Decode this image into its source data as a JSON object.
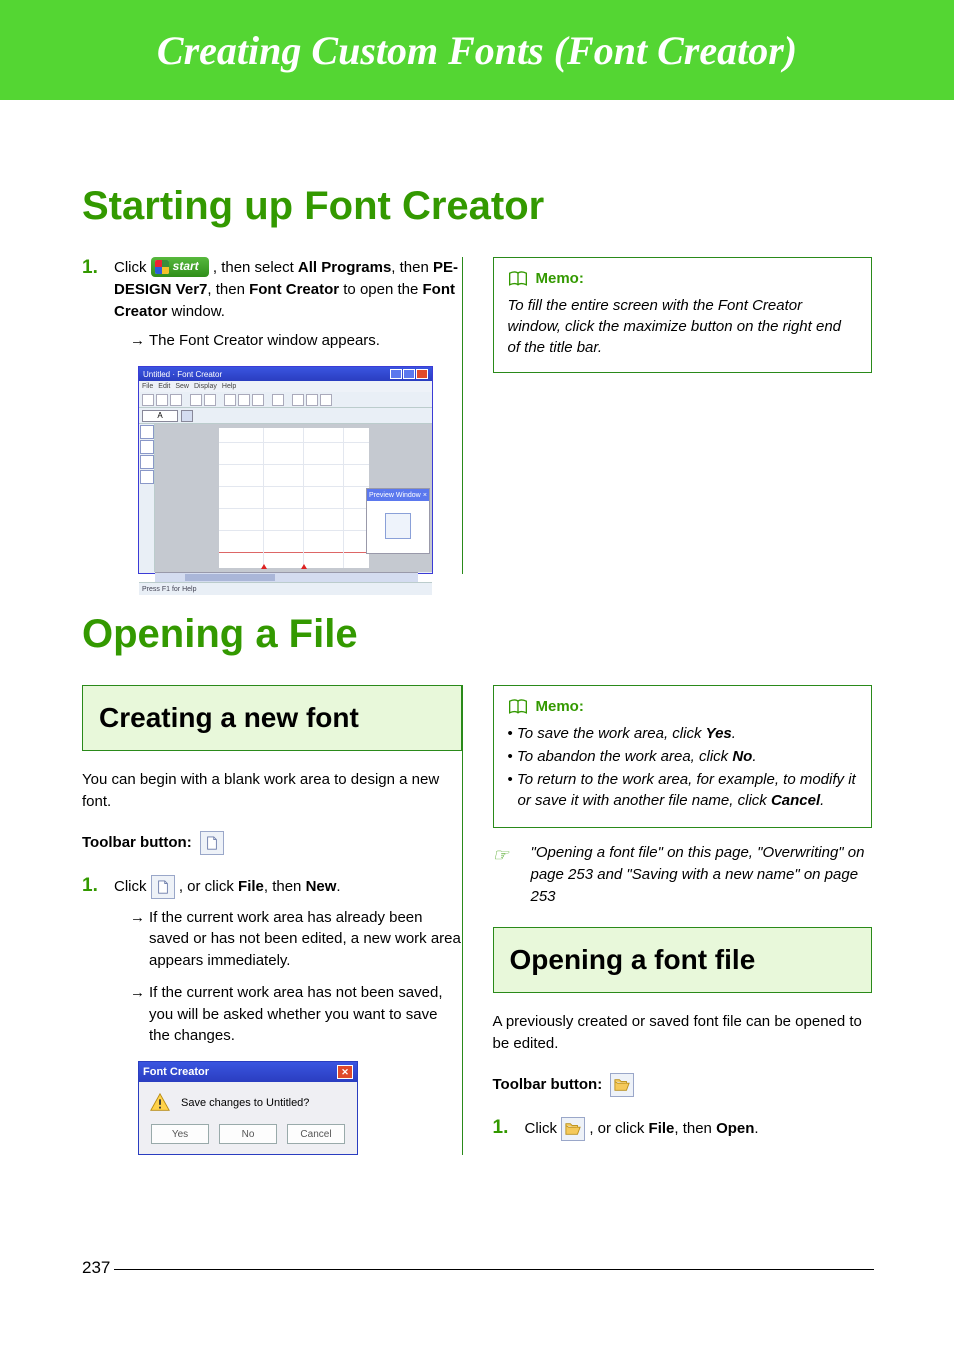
{
  "banner": {
    "title": "Creating Custom Fonts (Font Creator)"
  },
  "section1": {
    "heading": "Starting up Font Creator",
    "step1_prefix": "Click ",
    "start_label": "start",
    "step1_mid": ", then select ",
    "step1_b1": "All Programs",
    "step1_mid2": ", then ",
    "step1_b2": "PE-DESIGN Ver7",
    "step1_mid3": ", then ",
    "step1_b3": "Font Creator",
    "step1_mid4": " to open the ",
    "step1_b4": "Font Creator",
    "step1_end": " window.",
    "result": "The Font Creator window appears.",
    "fc_title": "Untitled · Font Creator",
    "fc_menu": [
      "File",
      "Edit",
      "Sew",
      "Display",
      "Help"
    ],
    "fc_char": "A",
    "fc_preview_title": "Preview Window",
    "fc_status_left": "Press F1 for Help",
    "memo_title": "Memo:",
    "memo_body": "To fill the entire screen with the Font Creator window, click the maximize button on the right end of the title bar."
  },
  "section2": {
    "heading": "Opening a File",
    "sub1": {
      "title": "Creating a new font",
      "intro": "You can begin with a blank work area to design a new font.",
      "toolbar_label": "Toolbar button:",
      "step1_prefix": "Click ",
      "step1_mid": ", or click ",
      "step1_b1": "File",
      "step1_mid2": ", then ",
      "step1_b2": "New",
      "step1_end": ".",
      "res1": "If the current work area has already been saved or has not been edited, a new work area appears immediately.",
      "res2": "If the current work area has not been saved, you will be asked whether you want to save the changes.",
      "dialog_title": "Font Creator",
      "dialog_msg": "Save changes to Untitled?",
      "btn_yes": "Yes",
      "btn_no": "No",
      "btn_cancel": "Cancel"
    },
    "memo2": {
      "title": "Memo:",
      "li1_a": "To save the work area, click ",
      "li1_b": "Yes",
      "li1_c": ".",
      "li2_a": "To abandon the work area, click ",
      "li2_b": "No",
      "li2_c": ".",
      "li3_a": "To return to the work area, for example, to modify it or save it with another file name, click ",
      "li3_b": "Cancel",
      "li3_c": "."
    },
    "crossref": "\"Opening a font file\"  on this page, \"Overwriting\" on page 253 and \"Saving with a new name\" on page 253",
    "sub2": {
      "title": "Opening a font file",
      "intro": "A previously created or saved font file can be opened to be edited.",
      "toolbar_label": "Toolbar button:",
      "step1_prefix": "Click ",
      "step1_mid": ", or click ",
      "step1_b1": "File",
      "step1_mid2": ", then ",
      "step1_b2": "Open",
      "step1_end": "."
    }
  },
  "page_number": "237"
}
